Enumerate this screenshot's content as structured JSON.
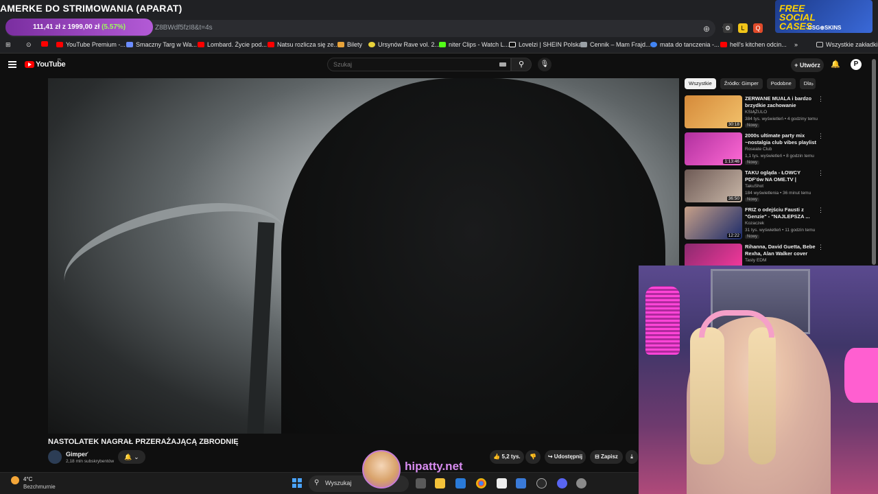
{
  "overlay": {
    "stream_title": "AMERKE DO STRIMOWANIA (APARAT)",
    "donation_text": "111,41 zł z 1999,00 zł",
    "donation_pct": "(5.57%)",
    "promo_line1": "FREE SOCIAL CASES",
    "promo_line2": "CSG⊕SKINS",
    "hipatty": "hipatty.net"
  },
  "browser": {
    "url_fragment": "Z8BWdf5fzI8&t=4s",
    "bookmarks": [
      "YouTube Premium -...",
      "Smaczny Targ w Wa...",
      "Lombard. Życie pod...",
      "Natsu rozlicza się ze...",
      "Bilety",
      "Ursynów Rave vol. 2...",
      "niter Clips - Watch L...",
      "Lovelzi | SHEIN Polska",
      "Cennik – Mam Frajd...",
      "mata do tanczenia -...",
      "hell's kitchen odcin..."
    ],
    "all_bookmarks": "Wszystkie zakładki"
  },
  "youtube": {
    "logo_text": "YouTube",
    "region": "PL",
    "search_placeholder": "Szukaj",
    "create_label": "Utwórz",
    "video_title": "NASTOLATEK NAGRAŁ PRZERAŻAJĄCĄ ZBRODNIĘ",
    "channel_name": "Gimper",
    "subscribers": "2,18 mln subskrybentów",
    "likes": "5,2 tys.",
    "share_label": "Udostępnij",
    "save_label": "Zapisz",
    "chips": [
      "Wszystkie",
      "Źródło: Gimper",
      "Podobne",
      "Dla"
    ],
    "recommendations": [
      {
        "title": "ZERWANE MUALA i bardzo brzydkie zachowanie",
        "channel": "KSIĄŻULO",
        "meta": "384 tys. wyświetleń • 4 godziny temu",
        "badge": "Nowy",
        "duration": "30:18",
        "color": "#d58a3a"
      },
      {
        "title": "2000s ultimate party mix ~nostalgia club vibes playlist",
        "channel": "Roseate Club",
        "meta": "1,1 tys. wyświetleń • 8 godzin temu",
        "badge": "Nowy",
        "duration": "1:13:46",
        "color": "#b0309e"
      },
      {
        "title": "TAKU ogląda - ŁOWCY PDF'ów NA OME.TV | w/NEEX, ...",
        "channel": "TakuShot",
        "meta": "184 wyświetlenia • 36 minut temu",
        "badge": "Nowy",
        "duration": "36:50",
        "color": "#6e5a55"
      },
      {
        "title": "FRIZ o odejściu Fausti z \"Genzie\" - \"NAJLEPSZA ...",
        "channel": "Kozaczek",
        "meta": "31 tys. wyświetleń • 11 godzin temu",
        "badge": "Nowy",
        "duration": "12:22",
        "color": "#c7a088"
      },
      {
        "title": "Rihanna, David Guetta, Bebe Rexha, Alan Walker cover style...",
        "channel": "Tasty EDM",
        "meta": "",
        "badge": "",
        "duration": "",
        "color": "#8a2a6e"
      }
    ]
  },
  "taskbar": {
    "temp": "4°C",
    "weather": "Bezchmurnie",
    "search_label": "Wyszukaj"
  }
}
